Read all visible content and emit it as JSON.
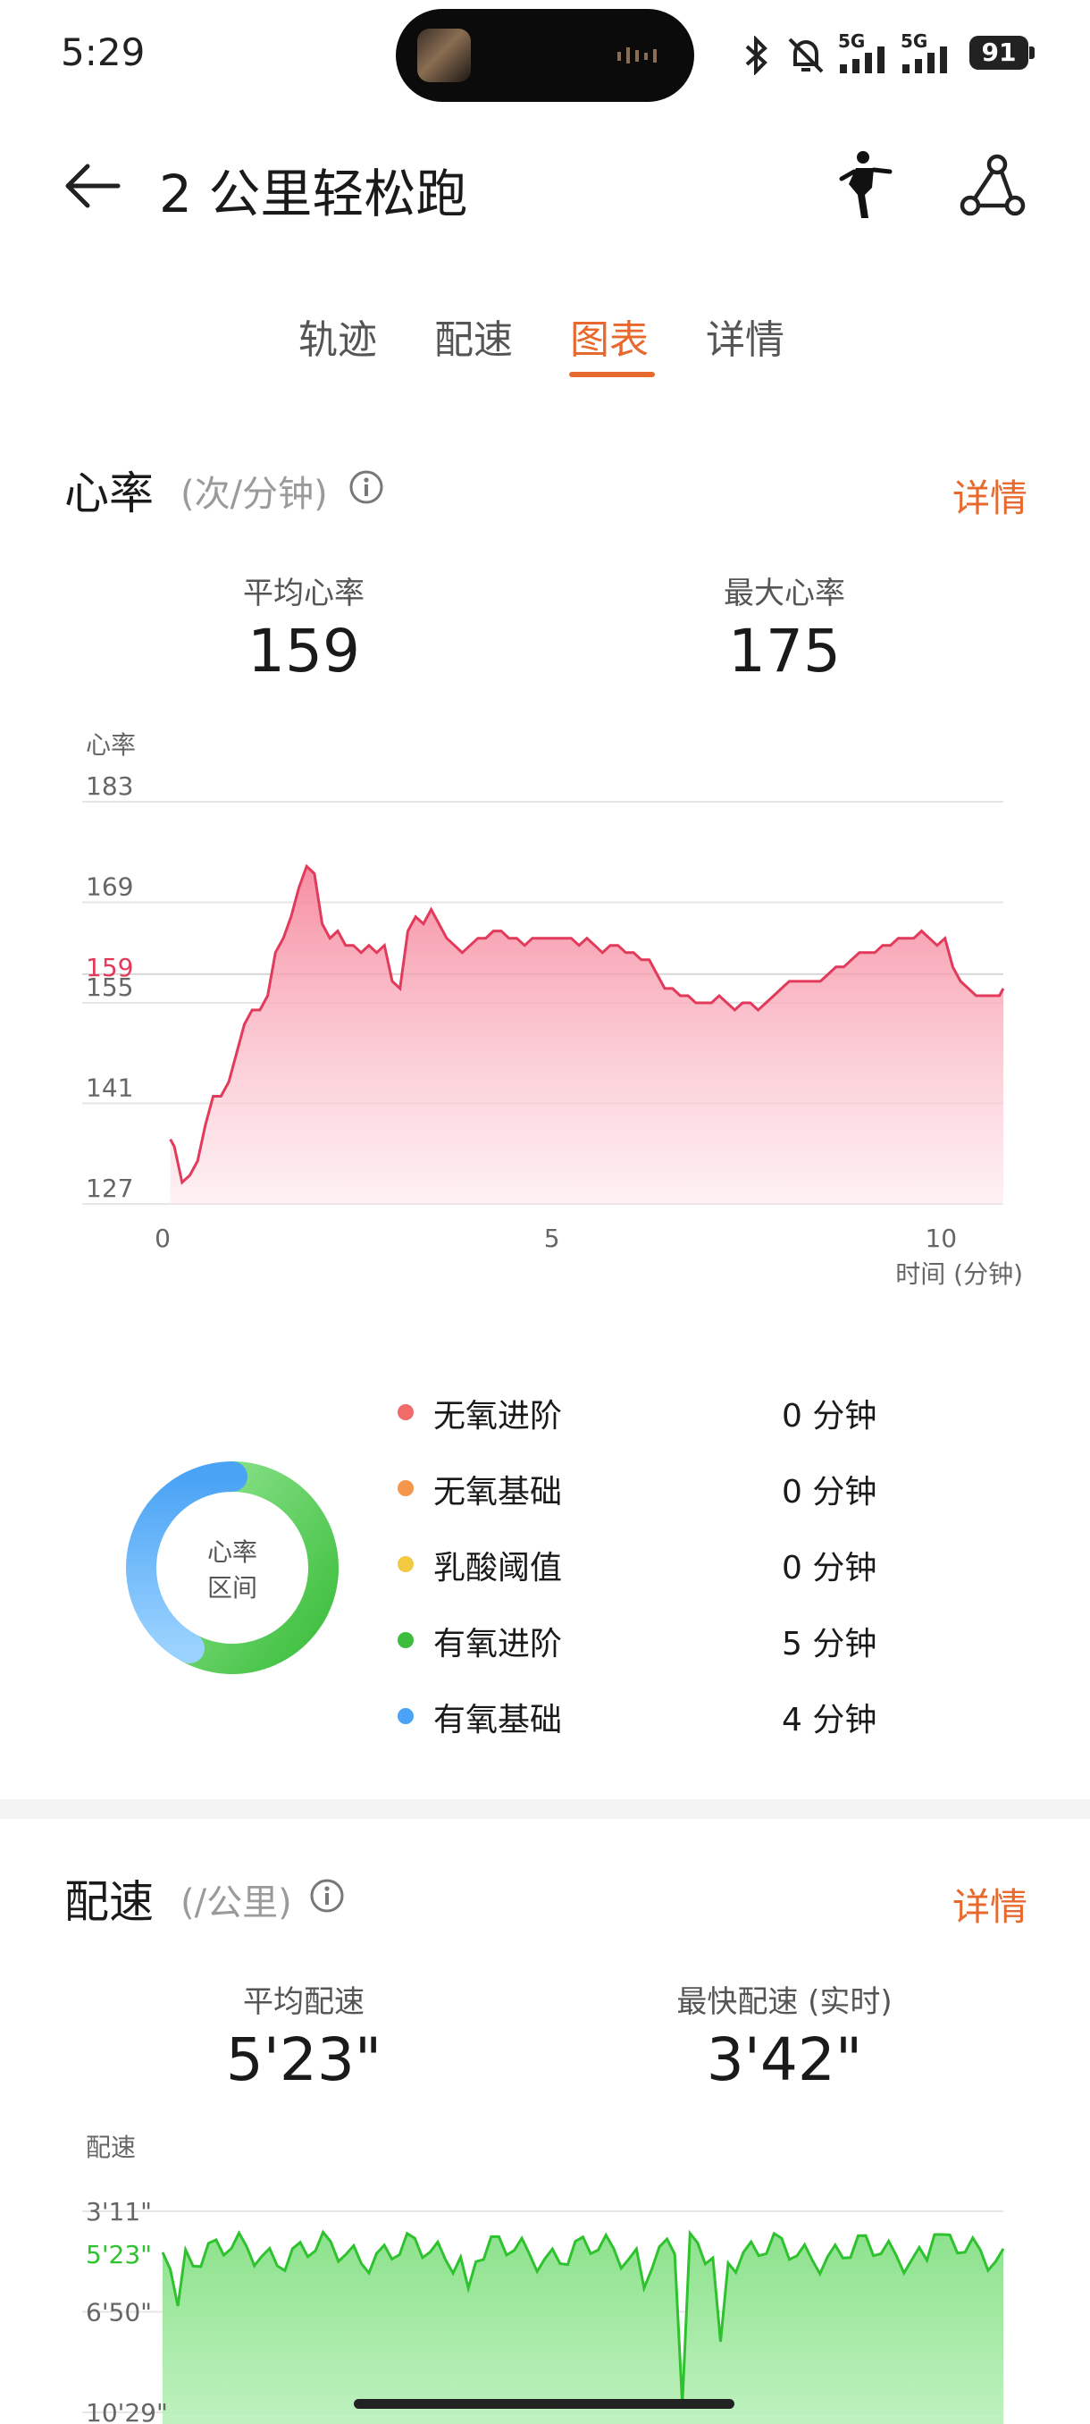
{
  "status": {
    "time": "5:29",
    "battery": "91",
    "net1": "5G",
    "net2": "5G"
  },
  "header": {
    "title": "2 公里轻松跑"
  },
  "tabs": [
    {
      "label": "轨迹"
    },
    {
      "label": "配速"
    },
    {
      "label": "图表"
    },
    {
      "label": "详情"
    }
  ],
  "active_tab": "图表",
  "heart": {
    "title": "心率",
    "unit": "(次/分钟)",
    "detail": "详情",
    "avg_label": "平均心率",
    "avg_value": "159",
    "max_label": "最大心率",
    "max_value": "175",
    "zone_center_line1": "心率",
    "zone_center_line2": "区间",
    "zones": [
      {
        "name": "无氧进阶",
        "value": "0 分钟",
        "color": "#f26b6b"
      },
      {
        "name": "无氧基础",
        "value": "0 分钟",
        "color": "#f5964a"
      },
      {
        "name": "乳酸阈值",
        "value": "0 分钟",
        "color": "#f2c940"
      },
      {
        "name": "有氧进阶",
        "value": "5 分钟",
        "color": "#3cbe3c"
      },
      {
        "name": "有氧基础",
        "value": "4 分钟",
        "color": "#4aa3f5"
      }
    ]
  },
  "pace": {
    "title": "配速",
    "unit": "(/公里)",
    "detail": "详情",
    "avg_label": "平均配速",
    "avg_value": "5'23\"",
    "max_label": "最快配速 (实时)",
    "max_value": "3'42\""
  },
  "colors": {
    "accent": "#e8692e",
    "heart_line": "#e23a5a",
    "pace_line": "#2ec22e"
  },
  "chart_data": [
    {
      "type": "area",
      "ylabel": "心率",
      "xlabel": "时间 (分钟)",
      "y_ticks": [
        "183",
        "169",
        "155",
        "141",
        "127"
      ],
      "y_tick_values": [
        183,
        169,
        155,
        141,
        127
      ],
      "x_ticks": [
        "0",
        "5",
        "10"
      ],
      "x_tick_values": [
        0,
        5,
        10
      ],
      "ylim": [
        127,
        183
      ],
      "xlim": [
        0,
        10.8
      ],
      "avg_line": {
        "label": "159",
        "value": 159
      },
      "x": [
        0.1,
        0.15,
        0.25,
        0.35,
        0.45,
        0.55,
        0.65,
        0.75,
        0.85,
        0.95,
        1.05,
        1.15,
        1.25,
        1.35,
        1.45,
        1.55,
        1.65,
        1.75,
        1.85,
        1.95,
        2.05,
        2.15,
        2.25,
        2.35,
        2.45,
        2.55,
        2.65,
        2.75,
        2.85,
        2.95,
        3.05,
        3.15,
        3.25,
        3.35,
        3.45,
        3.55,
        3.65,
        3.75,
        3.85,
        3.95,
        4.05,
        4.15,
        4.25,
        4.35,
        4.45,
        4.55,
        4.65,
        4.75,
        4.85,
        4.95,
        5.05,
        5.15,
        5.25,
        5.35,
        5.45,
        5.55,
        5.65,
        5.75,
        5.85,
        5.95,
        6.05,
        6.15,
        6.25,
        6.35,
        6.45,
        6.55,
        6.65,
        6.75,
        6.85,
        6.95,
        7.05,
        7.15,
        7.25,
        7.35,
        7.45,
        7.55,
        7.65,
        7.75,
        7.85,
        7.95,
        8.05,
        8.15,
        8.25,
        8.35,
        8.45,
        8.55,
        8.65,
        8.75,
        8.85,
        8.95,
        9.05,
        9.15,
        9.25,
        9.35,
        9.45,
        9.55,
        9.65,
        9.75,
        9.85,
        9.95,
        10.05,
        10.15,
        10.25,
        10.35,
        10.45,
        10.55,
        10.65,
        10.75,
        10.8
      ],
      "series": [
        {
          "values": [
            136,
            135,
            130,
            131,
            133,
            138,
            142,
            142,
            144,
            148,
            152,
            154,
            154,
            156,
            162,
            164,
            167,
            171,
            174,
            173,
            166,
            164,
            165,
            163,
            163,
            162,
            163,
            162,
            163,
            158,
            157,
            165,
            167,
            166,
            168,
            166,
            164,
            163,
            162,
            163,
            164,
            164,
            165,
            165,
            164,
            164,
            163,
            164,
            164,
            164,
            164,
            164,
            164,
            163,
            164,
            163,
            162,
            163,
            163,
            162,
            162,
            161,
            161,
            159,
            157,
            157,
            156,
            156,
            155,
            155,
            155,
            156,
            155,
            154,
            155,
            155,
            154,
            155,
            156,
            157,
            158,
            158,
            158,
            158,
            158,
            159,
            160,
            160,
            161,
            162,
            162,
            162,
            163,
            163,
            164,
            164,
            164,
            165,
            164,
            163,
            164,
            160,
            158,
            157,
            156,
            156,
            156,
            156,
            157
          ]
        }
      ]
    },
    {
      "type": "area",
      "ylabel": "配速",
      "y_ticks": [
        "3'11\"",
        "6'50\"",
        "10'29\""
      ],
      "y_tick_values": [
        191,
        410,
        629
      ],
      "ylim": [
        191,
        629
      ],
      "avg_line": {
        "label": "5'23\"",
        "value": 323
      }
    }
  ]
}
